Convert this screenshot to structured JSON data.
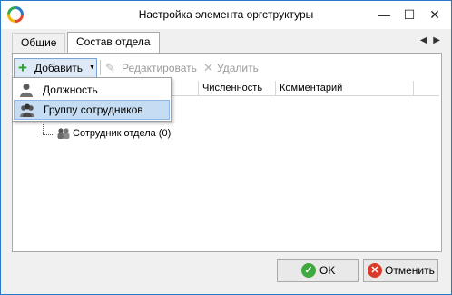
{
  "window": {
    "title": "Настройка элемента оргструктуры",
    "controls": {
      "minimize": "—",
      "maximize": "☐",
      "close": "✕"
    }
  },
  "tabs": [
    {
      "label": "Общие",
      "active": false
    },
    {
      "label": "Состав отдела",
      "active": true
    }
  ],
  "tab_scroll": "◀ ▶",
  "toolbar": {
    "add_label": "Добавить",
    "add_icon": "plus-icon",
    "edit_label": "Редактировать",
    "edit_icon": "pencil-icon",
    "delete_label": "Удалить",
    "delete_icon": "cross-icon"
  },
  "grid": {
    "columns": [
      "Численность",
      "Комментарий"
    ]
  },
  "tree": {
    "items": [
      {
        "label": "Сотрудник отдела (0)",
        "icon": "employee-group-icon"
      }
    ]
  },
  "dropdown_menu": {
    "items": [
      {
        "label": "Должность",
        "icon": "person-icon",
        "highlighted": false
      },
      {
        "label": "Группу сотрудников",
        "icon": "group-icon",
        "highlighted": true
      }
    ]
  },
  "buttons": {
    "ok": "OK",
    "cancel": "Отменить"
  },
  "colors": {
    "accent": "#2b79c4",
    "menu_highlight": "#c5dcf3",
    "ok_icon": "#3fa83f",
    "cancel_icon": "#d93a2a"
  }
}
